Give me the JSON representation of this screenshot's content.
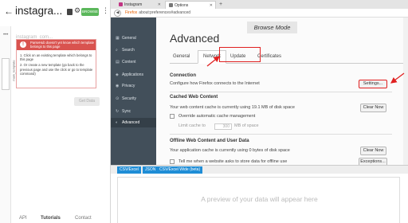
{
  "parsehub": {
    "back_glyph": "←",
    "project_title": "instagra...",
    "browse_toggle": "BROWSE",
    "side_dots": "•••",
    "side_tab_label": "main_template",
    "ghost_text": "instagram_com...",
    "alert": {
      "title": "ParseHub doesn't yet know which template belongs to this page",
      "steps": [
        "1. Click on an existing template which belongs to this page",
        "2. Or create a new template (go back to the previous page and use the click or go to template command)"
      ]
    },
    "disabled_button": "Get Data",
    "footer_tabs": [
      "API",
      "Tutorials",
      "Contact"
    ]
  },
  "browser": {
    "tabs": [
      {
        "label": "Instagram",
        "icon_color": "#c13584"
      },
      {
        "label": "Options",
        "icon_color": "#777777"
      }
    ],
    "new_tab_glyph": "+",
    "url_prefix": "Firefox",
    "url": "about:preferences#advanced"
  },
  "prefs_sidebar": {
    "items": [
      {
        "icon": "▦",
        "label": "General"
      },
      {
        "icon": "⌕",
        "label": "Search"
      },
      {
        "icon": "▤",
        "label": "Content"
      },
      {
        "icon": "◈",
        "label": "Applications"
      },
      {
        "icon": "◉",
        "label": "Privacy"
      },
      {
        "icon": "⊙",
        "label": "Security"
      },
      {
        "icon": "↻",
        "label": "Sync"
      },
      {
        "icon": "◐",
        "label": "Advanced"
      }
    ],
    "active_index": 7
  },
  "prefs": {
    "heading": "Advanced",
    "browse_mode": "Browse Mode",
    "tabs": [
      "General",
      "Network",
      "Update",
      "Certificates"
    ],
    "selected_tab": "Network",
    "connection": {
      "title": "Connection",
      "text": "Configure how Firefox connects to the Internet",
      "button": "Settings..."
    },
    "cached": {
      "title": "Cached Web Content",
      "text": "Your web content cache is currently using 19.1 MB of disk space",
      "button": "Clear Now",
      "override_label": "Override automatic cache management",
      "limit_prefix": "Limit cache to",
      "limit_value": "300",
      "limit_suffix": "MB of space"
    },
    "offline": {
      "title": "Offline Web Content and User Data",
      "text": "Your application cache is currently using 0 bytes of disk space",
      "button": "Clear Now",
      "partial_text": "Tell me when a website asks to store data for offline use",
      "partial_button": "Exceptions..."
    }
  },
  "results": {
    "tabs": [
      "CSV/Excel",
      "JSON",
      "CSV/Excel Wide (beta)"
    ],
    "preview_text": "A preview of your data will appear here"
  },
  "colors": {
    "alert_red": "#d9534f",
    "annotation_red": "#e02020",
    "prefs_sidebar": "#424f5a",
    "results_tab_blue": "#1f8dd6",
    "browse_green": "#5bb75b"
  }
}
